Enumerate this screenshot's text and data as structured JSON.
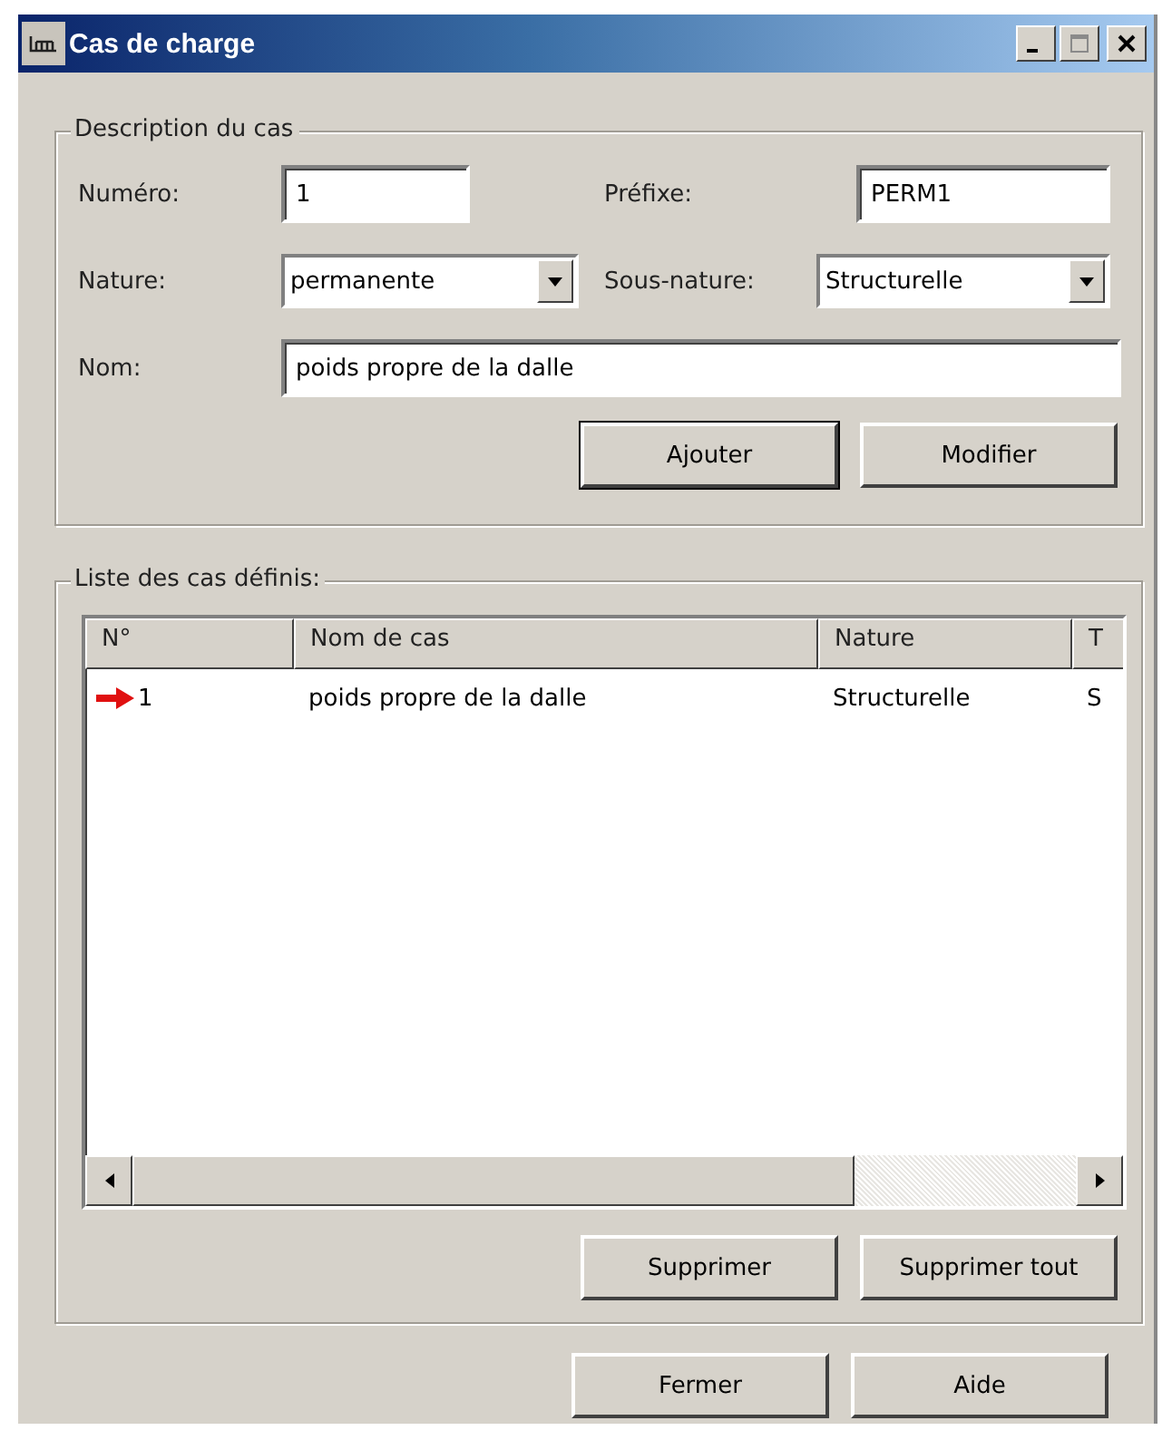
{
  "window": {
    "title": "Cas de charge"
  },
  "description": {
    "legend": "Description du cas",
    "numero": {
      "label": "Numéro:",
      "value": "1"
    },
    "prefixe": {
      "label": "Préfixe:",
      "value": "PERM1"
    },
    "nature": {
      "label": "Nature:",
      "value": "permanente"
    },
    "sous_nature": {
      "label": "Sous-nature:",
      "value": "Structurelle"
    },
    "nom": {
      "label": "Nom:",
      "value": "poids propre de la dalle"
    },
    "buttons": [
      {
        "label": "Ajouter",
        "default": true
      },
      {
        "label": "Modifier",
        "default": false
      }
    ]
  },
  "list": {
    "legend": "Liste des cas définis:",
    "columns": [
      "N°",
      "Nom de cas",
      "Nature",
      "T"
    ],
    "rows": [
      {
        "cells": [
          "1",
          "poids propre de la dalle",
          "Structurelle",
          "S"
        ],
        "current": true
      }
    ],
    "buttons": [
      "Supprimer",
      "Supprimer tout"
    ]
  },
  "buttons": [
    "Fermer",
    "Aide"
  ]
}
